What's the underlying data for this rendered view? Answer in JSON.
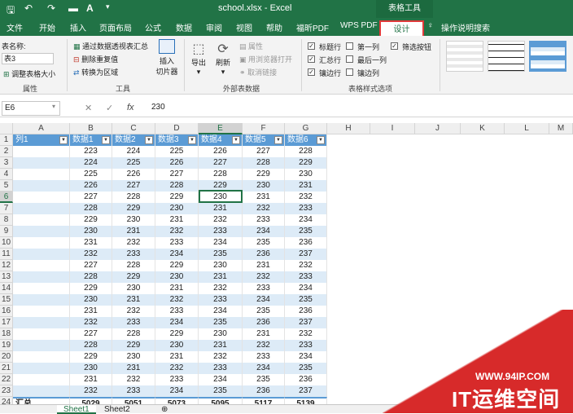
{
  "titlebar": {
    "filename": "school.xlsx",
    "separator": "-",
    "app": "Excel",
    "context_group": "表格工具"
  },
  "tabs": [
    "文件",
    "开始",
    "插入",
    "页面布局",
    "公式",
    "数据",
    "审阅",
    "视图",
    "帮助",
    "福昕PDF",
    "WPS PDF"
  ],
  "active_tab": "设计",
  "tell_me": "操作说明搜索",
  "ribbon": {
    "props": {
      "table_name_label": "表名称:",
      "table_name": "表3",
      "resize": "调整表格大小",
      "group": "属性"
    },
    "tools": {
      "pivot": "通过数据透视表汇总",
      "remove_dup": "删除重复值",
      "to_range": "转换为区域",
      "slicer_l1": "插入",
      "slicer_l2": "切片器",
      "group": "工具"
    },
    "external": {
      "export": "导出",
      "refresh": "刷新",
      "properties": "属性",
      "open_browser": "用浏览器打开",
      "unlink": "取消链接",
      "group": "外部表数据"
    },
    "style_opts": {
      "header_row": "标题行",
      "first_col": "第一列",
      "filter_btn": "筛选按钮",
      "total_row": "汇总行",
      "last_col": "最后一列",
      "banded_rows": "镶边行",
      "banded_cols": "镶边列",
      "group": "表格样式选项"
    }
  },
  "formula": {
    "name_box": "E6",
    "value": "230",
    "cancel": "✕",
    "enter": "✓",
    "fx": "fx"
  },
  "columns": [
    "A",
    "B",
    "C",
    "D",
    "E",
    "F",
    "G",
    "H",
    "I",
    "J",
    "K",
    "L",
    "M"
  ],
  "table_headers": [
    "列1",
    "数据1",
    "数据2",
    "数据3",
    "数据4",
    "数据5",
    "数据6"
  ],
  "rows": [
    [
      "223",
      "224",
      "225",
      "226",
      "227",
      "228"
    ],
    [
      "224",
      "225",
      "226",
      "227",
      "228",
      "229"
    ],
    [
      "225",
      "226",
      "227",
      "228",
      "229",
      "230"
    ],
    [
      "226",
      "227",
      "228",
      "229",
      "230",
      "231"
    ],
    [
      "227",
      "228",
      "229",
      "230",
      "231",
      "232"
    ],
    [
      "228",
      "229",
      "230",
      "231",
      "232",
      "233"
    ],
    [
      "229",
      "230",
      "231",
      "232",
      "233",
      "234"
    ],
    [
      "230",
      "231",
      "232",
      "233",
      "234",
      "235"
    ],
    [
      "231",
      "232",
      "233",
      "234",
      "235",
      "236"
    ],
    [
      "232",
      "233",
      "234",
      "235",
      "236",
      "237"
    ],
    [
      "227",
      "228",
      "229",
      "230",
      "231",
      "232"
    ],
    [
      "228",
      "229",
      "230",
      "231",
      "232",
      "233"
    ],
    [
      "229",
      "230",
      "231",
      "232",
      "233",
      "234"
    ],
    [
      "230",
      "231",
      "232",
      "233",
      "234",
      "235"
    ],
    [
      "231",
      "232",
      "233",
      "234",
      "235",
      "236"
    ],
    [
      "232",
      "233",
      "234",
      "235",
      "236",
      "237"
    ],
    [
      "227",
      "228",
      "229",
      "230",
      "231",
      "232"
    ],
    [
      "228",
      "229",
      "230",
      "231",
      "232",
      "233"
    ],
    [
      "229",
      "230",
      "231",
      "232",
      "233",
      "234"
    ],
    [
      "230",
      "231",
      "232",
      "233",
      "234",
      "235"
    ],
    [
      "231",
      "232",
      "233",
      "234",
      "235",
      "236"
    ],
    [
      "232",
      "233",
      "234",
      "235",
      "236",
      "237"
    ]
  ],
  "total_row": {
    "label": "汇总",
    "values": [
      "5029",
      "5051",
      "5073",
      "5095",
      "5117",
      "5139"
    ]
  },
  "sheets": [
    "Sheet1",
    "Sheet2"
  ],
  "watermark": {
    "url": "WWW.94IP.COM",
    "brand": "IT运维空间"
  },
  "colors": {
    "excel_green": "#217346",
    "table_header": "#5b9bd5",
    "band": "#ddebf7",
    "highlight": "#e03a3a"
  }
}
